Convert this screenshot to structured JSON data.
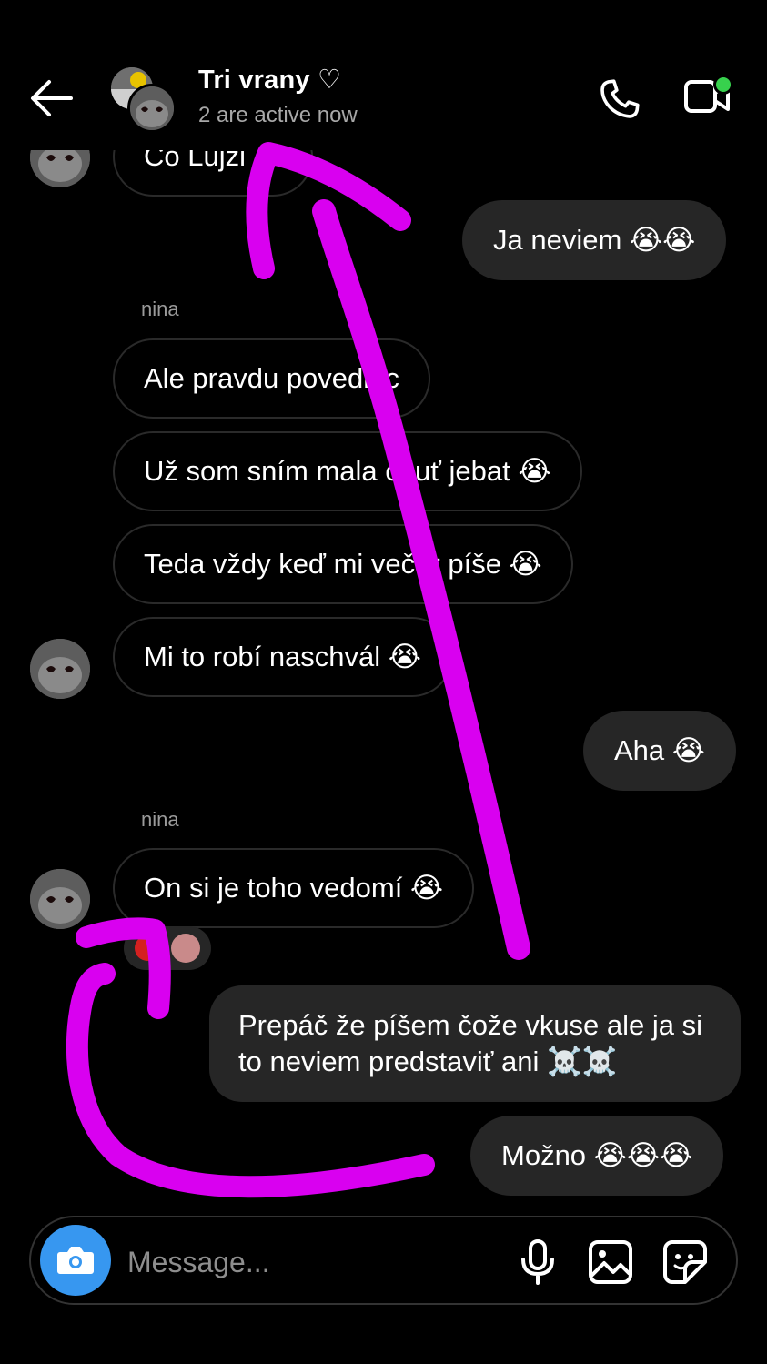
{
  "header": {
    "title": "Tri vrany ♡",
    "subtitle": "2 are active now"
  },
  "messages": {
    "m0": "Čo Lujzi",
    "m1": "Ja neviem 😭😭",
    "sender_a": "nina",
    "m2": "Ale pravdu povediac",
    "m3": "Už som sním mala chuť jebat 😭",
    "m4": "Teda vždy keď mi večer píše 😭",
    "m5": "Mi to robí naschvál 😭",
    "m6": "Aha 😭",
    "sender_b": "nina",
    "m7": "On si je toho vedomí 😭",
    "m8": "Prepáč že píšem čože vkuse ale ja si to neviem predstaviť ani ☠️☠️",
    "m9": "Možno 😭😭😭"
  },
  "composer": {
    "placeholder": "Message..."
  },
  "colors": {
    "background": "#000000",
    "outgoing_bubble": "#262626",
    "camera_button": "#3797f0",
    "annotation": "#d900f0",
    "active_dot": "#37d14d"
  },
  "icons": [
    "back-arrow-icon",
    "phone-icon",
    "video-icon",
    "camera-icon",
    "microphone-icon",
    "gallery-icon",
    "sticker-icon"
  ]
}
